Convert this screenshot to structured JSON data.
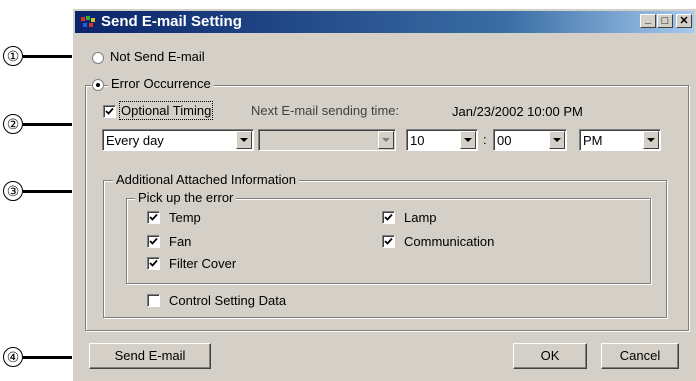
{
  "callouts": [
    "①",
    "②",
    "③",
    "④"
  ],
  "window": {
    "title": "Send E-mail Setting",
    "min_glyph": "_",
    "max_glyph": "□",
    "close_glyph": "✕"
  },
  "not_send": {
    "label": "Not Send E-mail",
    "selected": false
  },
  "error_occurrence": {
    "label": "Error Occurrence",
    "selected": true,
    "optional_timing": {
      "label": "Optional Timing",
      "checked": true
    },
    "next_label": "Next E-mail sending time:",
    "next_time": "Jan/23/2002 10:00 PM",
    "frequency": "Every day",
    "day": "",
    "hour": "10",
    "separator": ":",
    "minute": "00",
    "ampm": "PM",
    "additional": {
      "label": "Additional Attached Information",
      "pickup": {
        "label": "Pick up the error",
        "items": [
          {
            "label": "Temp",
            "checked": true
          },
          {
            "label": "Lamp",
            "checked": true
          },
          {
            "label": "Fan",
            "checked": true
          },
          {
            "label": "Communication",
            "checked": true
          },
          {
            "label": "Filter Cover",
            "checked": true
          }
        ]
      },
      "control_setting": {
        "label": "Control Setting Data",
        "checked": false
      }
    }
  },
  "buttons": {
    "send": "Send E-mail",
    "ok": "OK",
    "cancel": "Cancel"
  },
  "colors": {
    "face": "#d4d0c8",
    "title_start": "#0a246a",
    "title_end": "#a6caf0"
  }
}
